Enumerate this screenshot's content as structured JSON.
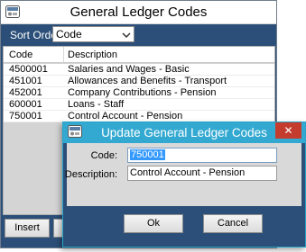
{
  "main_window": {
    "title": "General Ledger Codes",
    "sort_label": "Sort Order",
    "sort_value": "Code",
    "columns": {
      "code": "Code",
      "description": "Description"
    },
    "rows": [
      {
        "code": "4500001",
        "description": "Salaries and Wages - Basic"
      },
      {
        "code": "451001",
        "description": "Allowances and Benefits - Transport"
      },
      {
        "code": "452001",
        "description": "Company Contributions - Pension"
      },
      {
        "code": "600001",
        "description": "Loans - Staff"
      },
      {
        "code": "750001",
        "description": "Control Account - Pension"
      }
    ],
    "insert_label": "Insert"
  },
  "dialog": {
    "title": "Update General Ledger Codes",
    "close_glyph": "✕",
    "code_label": "Code:",
    "code_value": "750001",
    "description_label": "Description:",
    "description_value": "Control Account - Pension",
    "ok_label": "Ok",
    "cancel_label": "Cancel"
  },
  "colors": {
    "panel_blue": "#2b4f78",
    "dialog_title_blue": "#33a9d1",
    "close_red": "#c43c2e"
  },
  "icons": [
    "app-icon",
    "chevron-down-icon",
    "close-icon"
  ]
}
